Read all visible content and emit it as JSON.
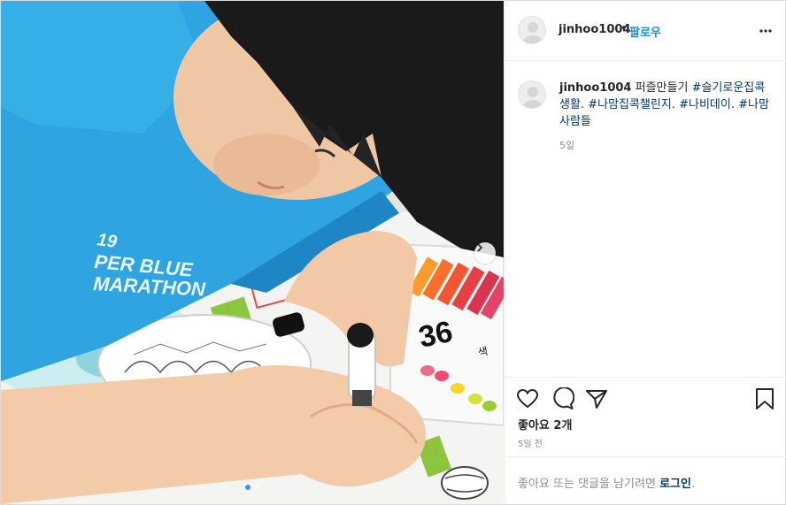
{
  "header": {
    "username": "jinhoo1004",
    "separator": "•",
    "follow_label": "팔로우",
    "more_icon": "more-options-icon"
  },
  "photo": {
    "shirt_text_lines": [
      "19",
      "PER BLUE",
      "MARATHON"
    ],
    "box_number": "36",
    "box_suffix": "색",
    "next_icon": "chevron-right-icon",
    "slides_total": 2,
    "current_slide": 1
  },
  "caption": {
    "username": "jinhoo1004",
    "text": "퍼즐만들기",
    "hashtags": [
      "#슬기로운집콕생활.",
      "#나맘집콕챌린지.",
      "#나비데이.",
      "#나맘사람들"
    ],
    "time": "5일"
  },
  "actions": {
    "icons": [
      "heart-icon",
      "comment-icon",
      "share-icon",
      "bookmark-icon"
    ],
    "likes_label": "좋아요 2개",
    "post_time": "5일 전"
  },
  "login_prompt": {
    "prefix": "좋아요 또는 댓글을 남기려면 ",
    "link": "로그인",
    "suffix": "."
  },
  "colors": {
    "accent_blue": "#0095f6",
    "hashtag": "#00376b",
    "muted": "#8e8e8e",
    "shirt": "#2fa4e0",
    "active_dot": "#3897f0"
  }
}
